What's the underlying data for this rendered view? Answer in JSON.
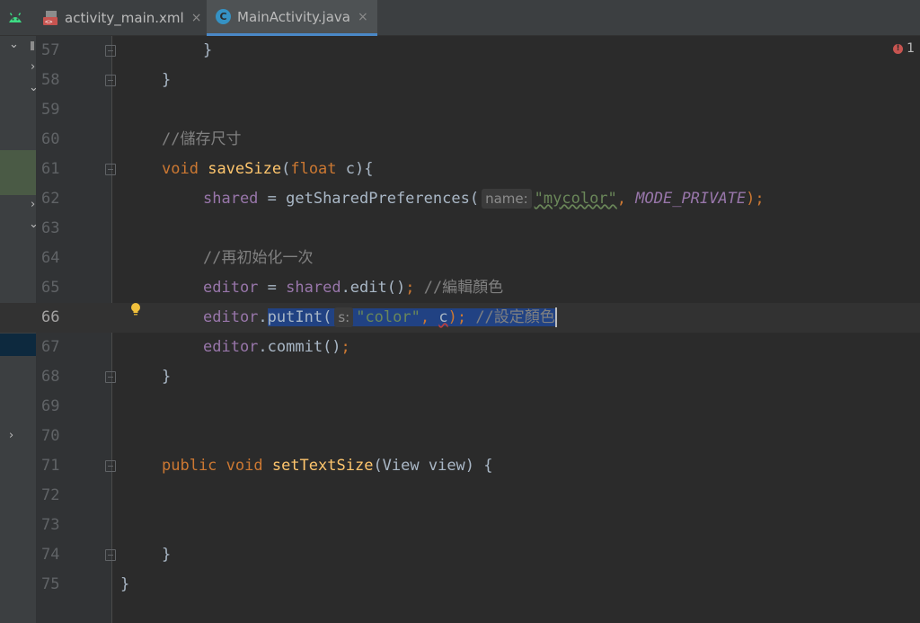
{
  "tabs": [
    {
      "label": "activity_main.xml",
      "close": "×"
    },
    {
      "label": "MainActivity.java",
      "close": "×",
      "icon_letter": "C"
    }
  ],
  "error_indicator": {
    "count": "1",
    "icon": "error-icon",
    "color": "#c75450"
  },
  "line_numbers": [
    "57",
    "58",
    "59",
    "60",
    "61",
    "62",
    "63",
    "64",
    "65",
    "66",
    "67",
    "68",
    "69",
    "70",
    "71",
    "72",
    "73",
    "74",
    "75"
  ],
  "code": {
    "l57": "}",
    "l58": "}",
    "l60_comment": "//儲存尺寸",
    "l61_void": "void",
    "l61_name": "saveSize",
    "l61_paren": "(",
    "l61_float": "float",
    "l61_rest": " c){",
    "l62_shared": "shared",
    "l62_eq": " = getSharedPreferences(",
    "l62_hint": "name:",
    "l62_str": "\"mycolor\"",
    "l62_comma": ", ",
    "l62_const": "MODE_PRIVATE",
    "l62_end": ");",
    "l64_comment": "//再初始化一次",
    "l65_editor": "editor",
    "l65_eq": " = ",
    "l65_shared": "shared",
    "l65_edit": ".edit()",
    "l65_semi": ";",
    "l65_comment": " //編輯顏色",
    "l66_editor": "editor",
    "l66_dot": ".",
    "l66_call": "putInt(",
    "l66_hint": "s:",
    "l66_str": "\"color\"",
    "l66_comma": ", ",
    "l66_c": "c",
    "l66_close": ");",
    "l66_comment": " //設定顏色",
    "l67_editor": "editor",
    "l67_commit": ".commit()",
    "l67_semi": ";",
    "l68": "}",
    "l71_public": "public",
    "l71_void": " void ",
    "l71_name": "setTextSize",
    "l71_params": "(View view) {",
    "l74": "}",
    "l75": "}"
  },
  "colors": {
    "keyword": "#cc7832",
    "field": "#9876aa",
    "comment": "#808080",
    "string": "#6a8759",
    "method": "#ffc66d",
    "selection": "#214283"
  }
}
